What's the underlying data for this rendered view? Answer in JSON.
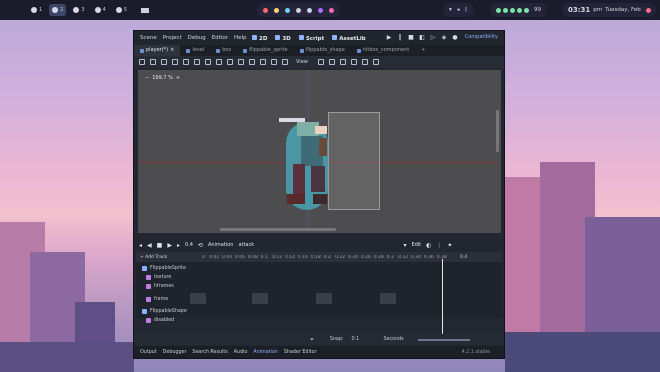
{
  "topbar": {
    "workspaces": [
      {
        "num": "1",
        "active": false
      },
      {
        "num": "2",
        "active": true
      },
      {
        "num": "3",
        "active": false
      },
      {
        "num": "4",
        "active": false
      },
      {
        "num": "5",
        "active": false
      }
    ],
    "battery": "99",
    "clock": "03:31",
    "meridiem": "pm",
    "date": "Tuesday, Feb 27"
  },
  "editor": {
    "menu": [
      "Scene",
      "Project",
      "Debug",
      "Editor",
      "Help"
    ],
    "modes": [
      "2D",
      "3D",
      "Script",
      "AssetLib"
    ],
    "renderer": "Compatibility",
    "tabs": [
      {
        "label": "player(*)",
        "active": true
      },
      {
        "label": "level",
        "active": false
      },
      {
        "label": "box",
        "active": false
      },
      {
        "label": "flippable_sprite",
        "active": false
      },
      {
        "label": "flippable_shape",
        "active": false
      },
      {
        "label": "hitbox_component",
        "active": false
      }
    ],
    "view_label": "View",
    "zoom": "199.7 %"
  },
  "animation": {
    "frame": "0.4",
    "label": "Animation",
    "name": "attack",
    "edit": "Edit",
    "add_track": "+ Add Track",
    "timeline": "0   0.02  0.04  0.06  0.08  0.1   0.12  0.14  0.16  0.18  0.2   0.22  0.24  0.26  0.28  0.3   0.32  0.34  0.36  0.38",
    "end_value": "0.4",
    "tracks": [
      {
        "label": "FlippableSprite",
        "type": "node"
      },
      {
        "label": "texture",
        "type": "prop"
      },
      {
        "label": "hframes",
        "type": "prop"
      },
      {
        "label": "frame",
        "type": "prop"
      },
      {
        "label": "FlippableShape",
        "type": "node"
      },
      {
        "label": "disabled",
        "type": "prop"
      }
    ],
    "snap_label": "Snap:",
    "snap_value": "0.1",
    "seconds": "Seconds",
    "version": "4.2.1.stable"
  },
  "bottom_tabs": [
    "Output",
    "Debugger",
    "Search Results",
    "Audio",
    "Animation",
    "Shader Editor"
  ],
  "colors": {
    "accent": "#8ab0ff",
    "shape": "#46bed2",
    "panel": "#232731"
  }
}
